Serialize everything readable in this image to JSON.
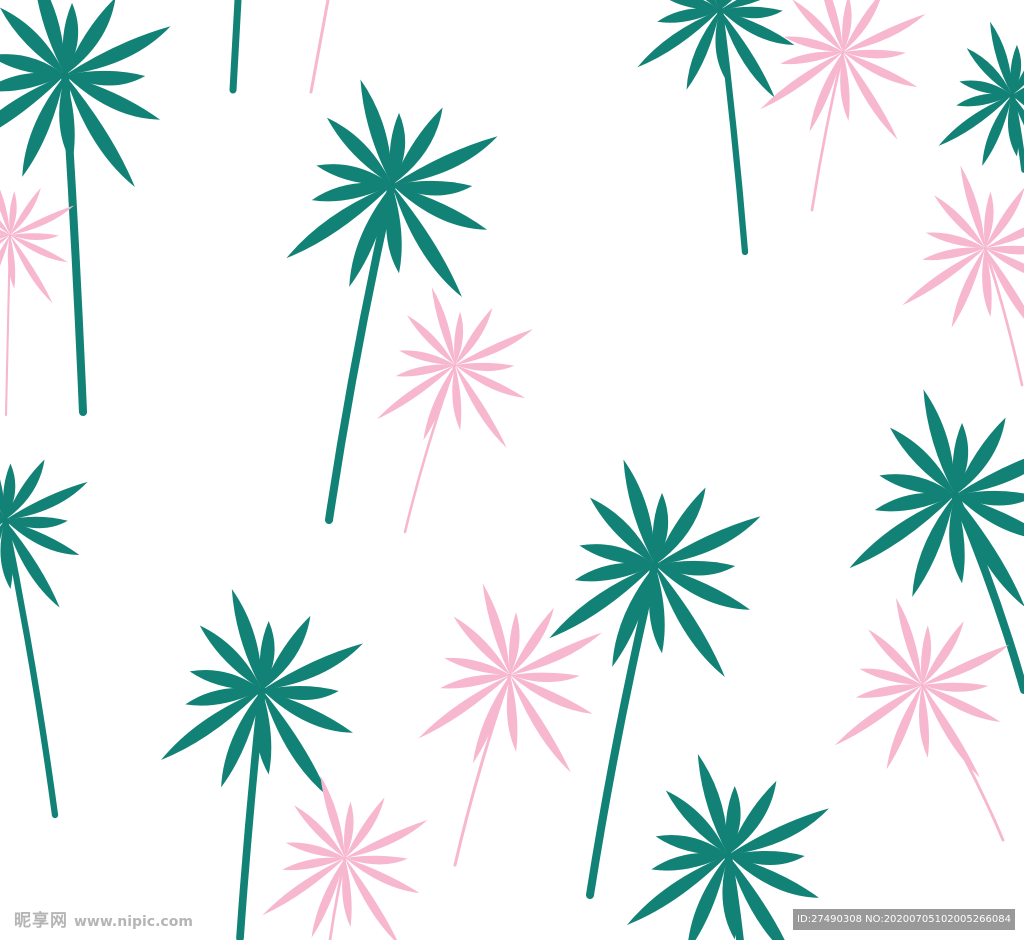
{
  "scene": {
    "subject": "seamless palm tree pattern",
    "colors": {
      "background": "#ffffff",
      "teal_palm": "#128276",
      "pink_palm": "#f7b7cf"
    }
  },
  "watermark": {
    "logo_text": "昵享网",
    "site": "www.nipic.com",
    "id_text": "ID:27490308 NO:20200705102005266084"
  }
}
